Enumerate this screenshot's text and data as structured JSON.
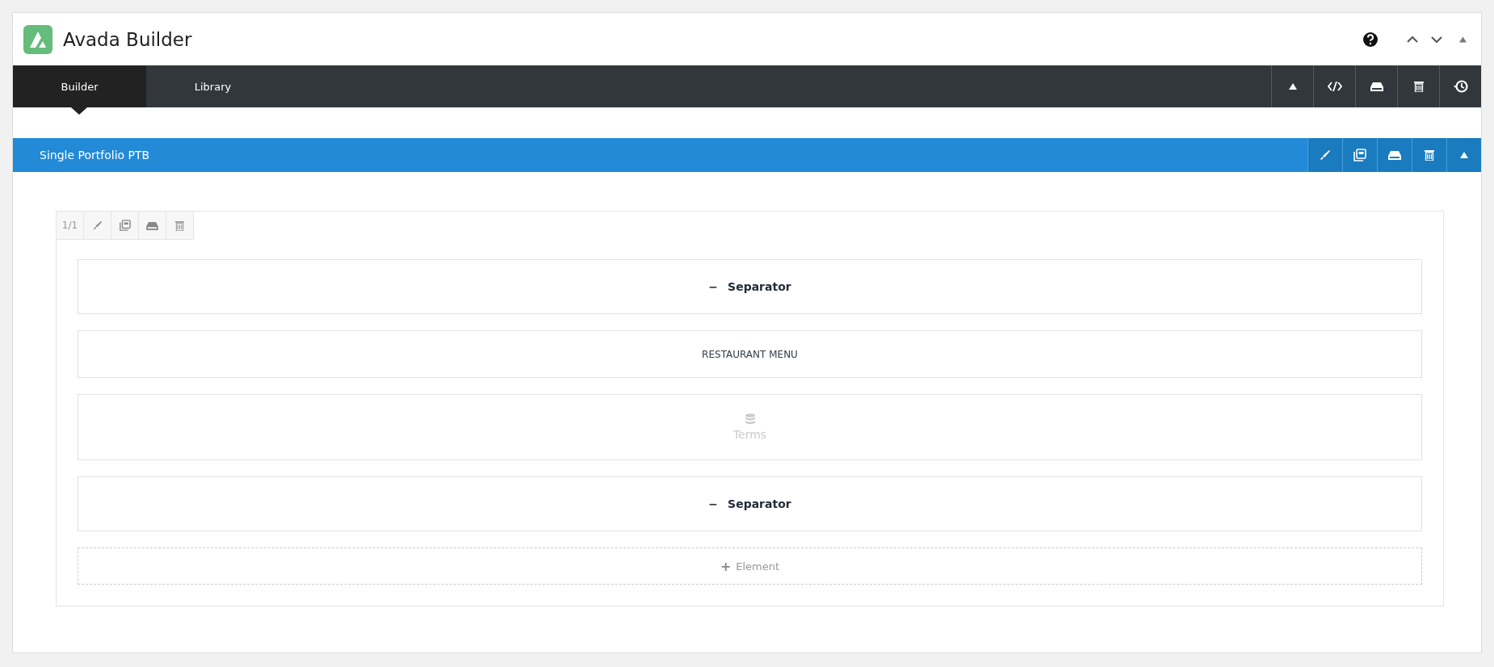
{
  "header": {
    "title": "Avada Builder"
  },
  "tabs": [
    {
      "label": "Builder",
      "selected": true
    },
    {
      "label": "Library",
      "selected": false
    }
  ],
  "container": {
    "title": "Single Portfolio PTB"
  },
  "column": {
    "size": "1/1"
  },
  "elements": [
    {
      "kind": "separator",
      "label": "Separator",
      "icon": "−"
    },
    {
      "kind": "text",
      "label": "RESTAURANT MENU"
    },
    {
      "kind": "terms",
      "label": "Terms"
    },
    {
      "kind": "separator",
      "label": "Separator",
      "icon": "−"
    },
    {
      "kind": "add",
      "label": "Element",
      "icon": "+"
    }
  ]
}
